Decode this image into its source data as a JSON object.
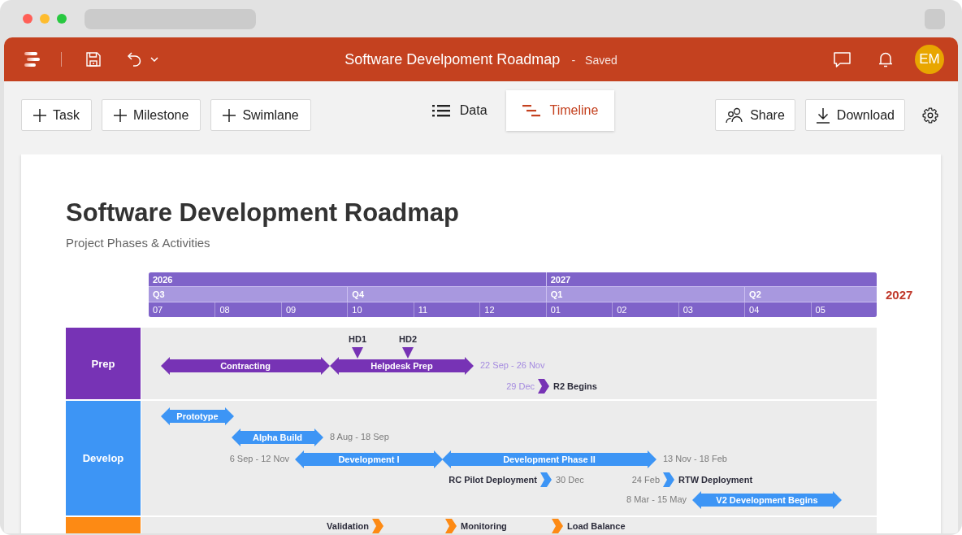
{
  "header": {
    "document_title": "Software Develpoment Roadmap",
    "separator": "-",
    "save_status": "Saved",
    "avatar_initials": "EM"
  },
  "toolbar": {
    "add_buttons": [
      "Task",
      "Milestone",
      "Swimlane"
    ],
    "tabs": [
      {
        "label": "Data",
        "selected": false
      },
      {
        "label": "Timeline",
        "selected": true
      }
    ],
    "actions": [
      "Share",
      "Download"
    ]
  },
  "document": {
    "title": "Software Development Roadmap",
    "subtitle": "Project Phases & Activities",
    "timeline": {
      "years": [
        "2026",
        "2027"
      ],
      "quarters": [
        "Q3",
        "Q4",
        "Q1",
        "Q2"
      ],
      "months": [
        "07",
        "08",
        "09",
        "10",
        "11",
        "12",
        "01",
        "02",
        "03",
        "04",
        "05"
      ],
      "end_label": "2027"
    },
    "swimlanes": [
      {
        "name": "Prep",
        "color": "#7733b5",
        "items": [
          {
            "kind": "marker",
            "label": "HD1"
          },
          {
            "kind": "marker",
            "label": "HD2"
          },
          {
            "kind": "task",
            "label": "Contracting"
          },
          {
            "kind": "task",
            "label": "Helpdesk Prep",
            "date_right": "22 Sep - 26 Nov"
          },
          {
            "kind": "milestone",
            "date_left": "29 Dec",
            "label_right": "R2 Begins"
          }
        ]
      },
      {
        "name": "Develop",
        "color": "#3d95f5",
        "items": [
          {
            "kind": "task",
            "label": "Prototype"
          },
          {
            "kind": "task",
            "label": "Alpha Build",
            "date_right": "8 Aug - 18 Sep"
          },
          {
            "kind": "task",
            "label": "Development I",
            "date_left": "6 Sep - 12 Nov"
          },
          {
            "kind": "task",
            "label": "Development Phase II",
            "date_right": "13 Nov - 18 Feb"
          },
          {
            "kind": "milestone",
            "label_left": "RC Pilot Deployment",
            "date_right": "30 Dec"
          },
          {
            "kind": "milestone",
            "date_left": "24 Feb",
            "label_right": "RTW Deployment"
          },
          {
            "kind": "task",
            "label": "V2 Development Begins",
            "date_left": "8 Mar - 15 May"
          }
        ]
      },
      {
        "color": "#fd8a14",
        "items": [
          {
            "kind": "milestone",
            "label_left": "Validation"
          },
          {
            "kind": "milestone",
            "label_right": "Monitoring"
          },
          {
            "kind": "milestone",
            "label_right": "Load Balance"
          }
        ]
      }
    ]
  }
}
